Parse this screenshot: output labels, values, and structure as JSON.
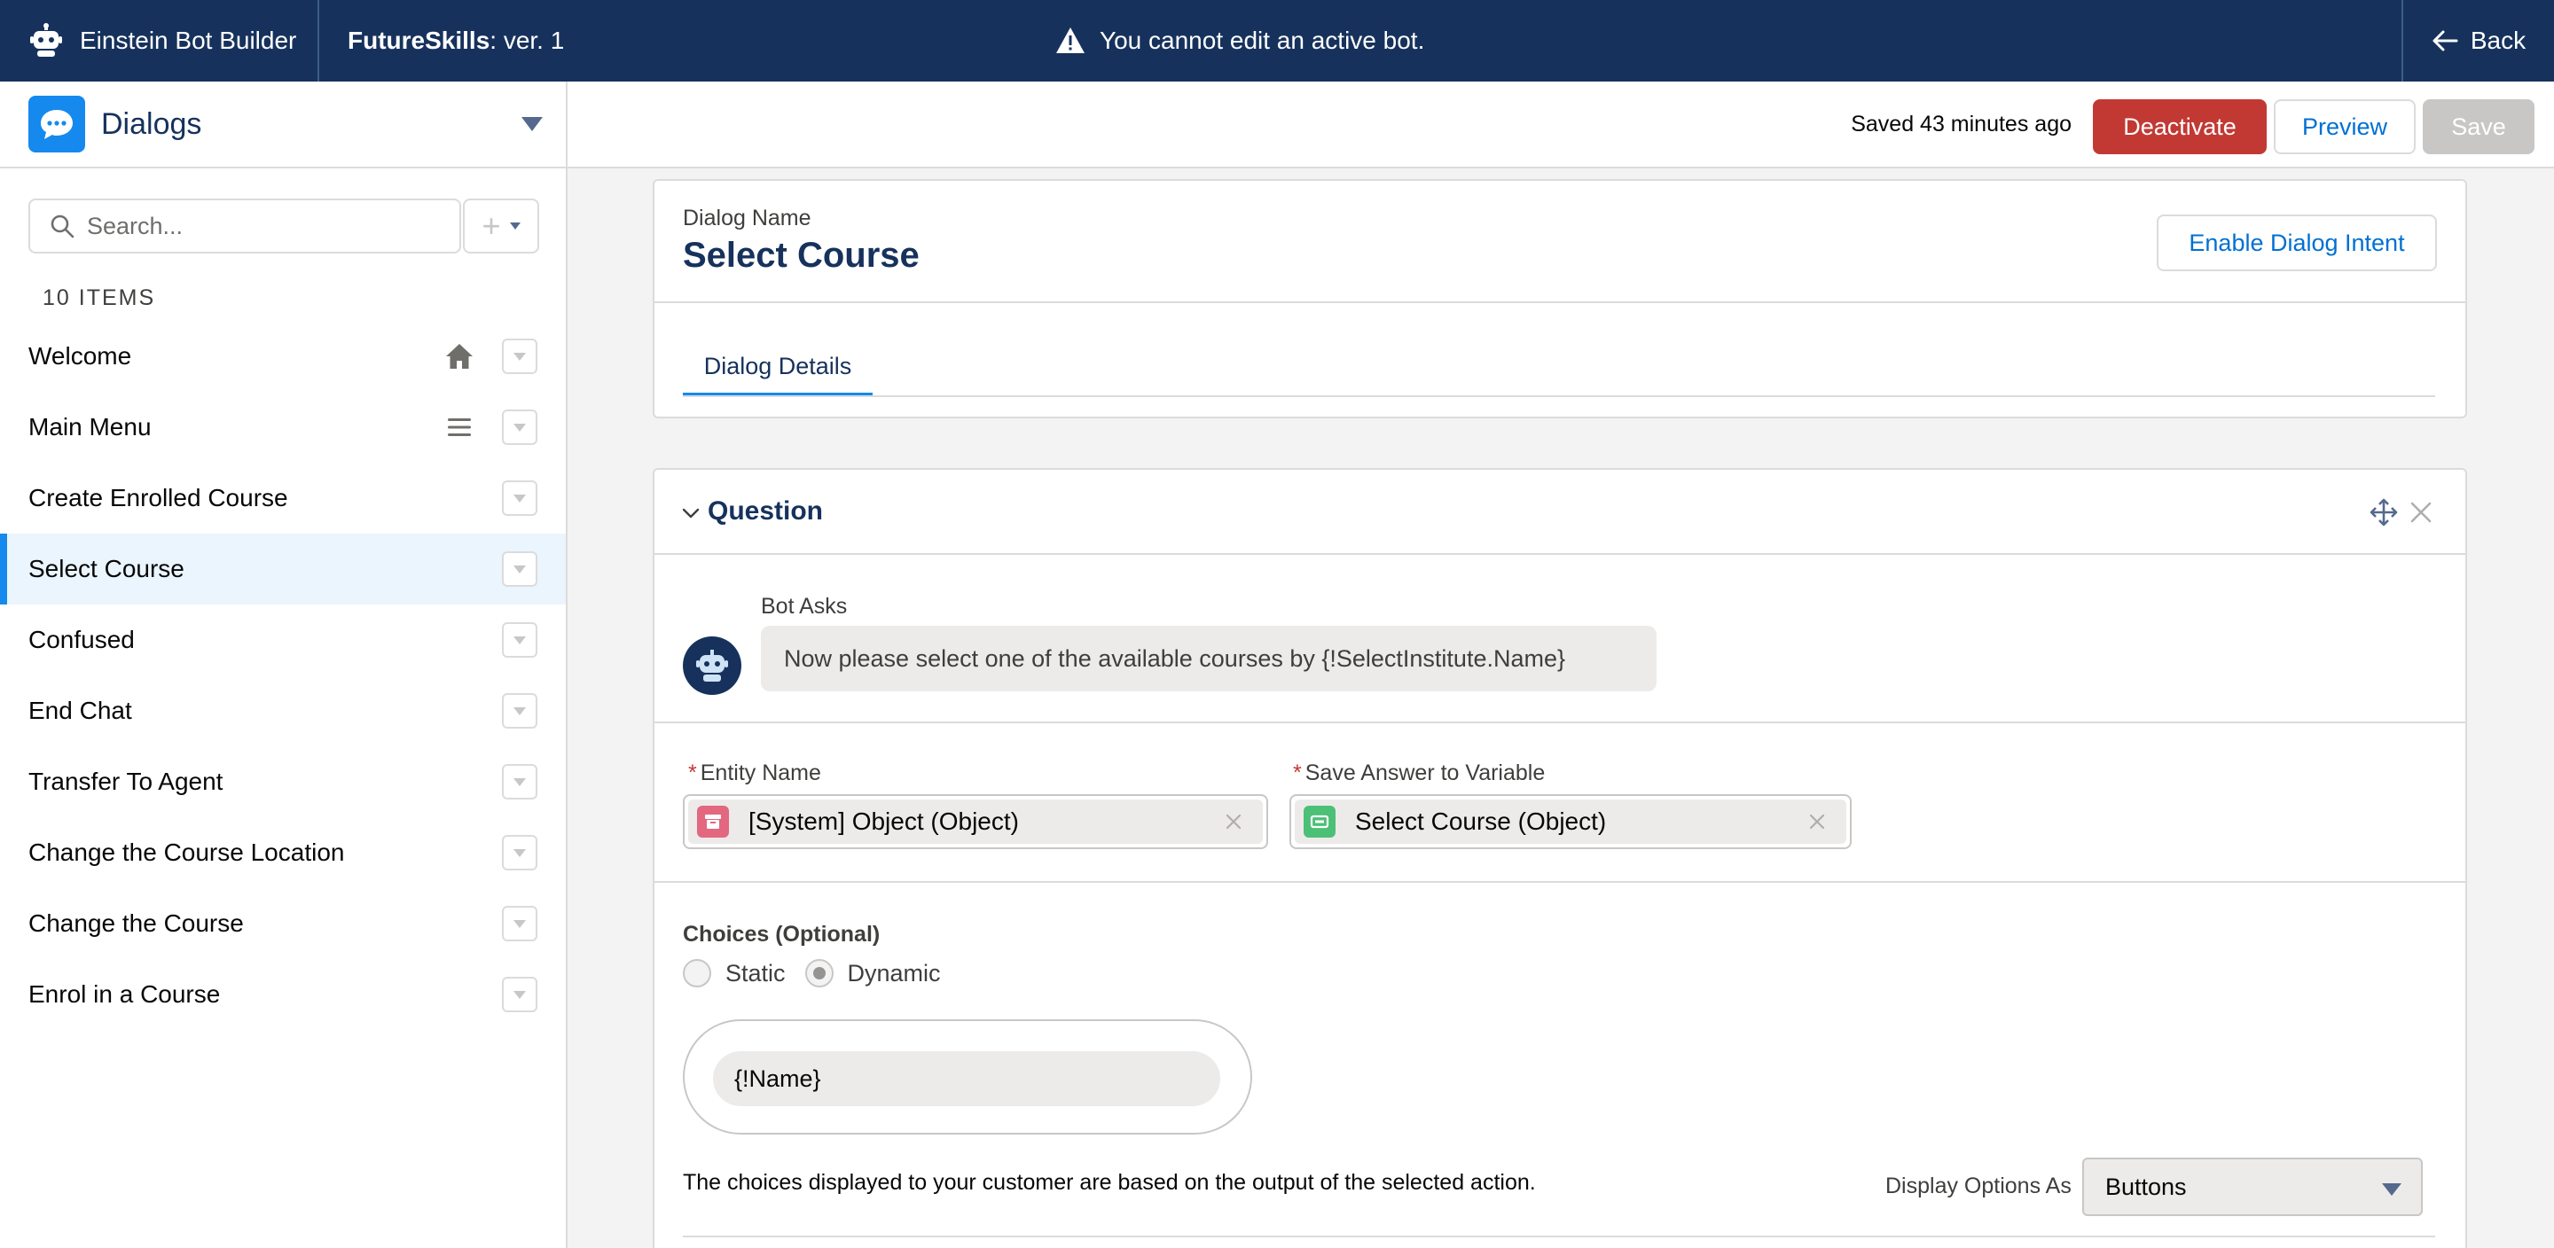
{
  "topbar": {
    "app_name": "Einstein Bot Builder",
    "bot_name": "FutureSkills",
    "bot_version": " : ver. 1",
    "warning": "You cannot edit an active bot.",
    "back_label": "Back"
  },
  "subheader": {
    "picker_label": "Dialogs",
    "saved_status": "Saved 43 minutes ago",
    "deactivate_label": "Deactivate",
    "preview_label": "Preview",
    "save_label": "Save"
  },
  "sidebar": {
    "search_placeholder": "Search...",
    "items_count": "10 ITEMS",
    "items": [
      {
        "label": "Welcome",
        "icon": "home-icon"
      },
      {
        "label": "Main Menu",
        "icon": "menu-icon"
      },
      {
        "label": "Create Enrolled Course"
      },
      {
        "label": "Select Course",
        "active": true
      },
      {
        "label": "Confused"
      },
      {
        "label": "End Chat"
      },
      {
        "label": "Transfer To Agent"
      },
      {
        "label": "Change the Course Location"
      },
      {
        "label": "Change the Course"
      },
      {
        "label": "Enrol in a Course"
      }
    ]
  },
  "dialog": {
    "name_label": "Dialog Name",
    "name": "Select Course",
    "enable_intent_label": "Enable Dialog Intent",
    "tab_label": "Dialog Details"
  },
  "question": {
    "title": "Question",
    "bot_asks_label": "Bot Asks",
    "bot_asks_text": "Now please select one of the available courses by {!SelectInstitute.Name}",
    "entity_label": "Entity Name",
    "entity_value": "[System] Object (Object)",
    "variable_label": "Save Answer to Variable",
    "variable_value": "Select Course (Object)",
    "choices_label": "Choices (Optional)",
    "radio_static": "Static",
    "radio_dynamic": "Dynamic",
    "choice_value": "{!Name}",
    "choices_help": "The choices displayed to your customer are based on the output of the selected action.",
    "display_label": "Display Options As",
    "display_value": "Buttons"
  },
  "colors": {
    "topbar": "#16325c",
    "brand_blue": "#1589ee",
    "link_blue": "#0070d2",
    "deactivate_red": "#c23934",
    "entity_icon_pink": "#e3677f",
    "variable_icon_green": "#4bc076"
  }
}
